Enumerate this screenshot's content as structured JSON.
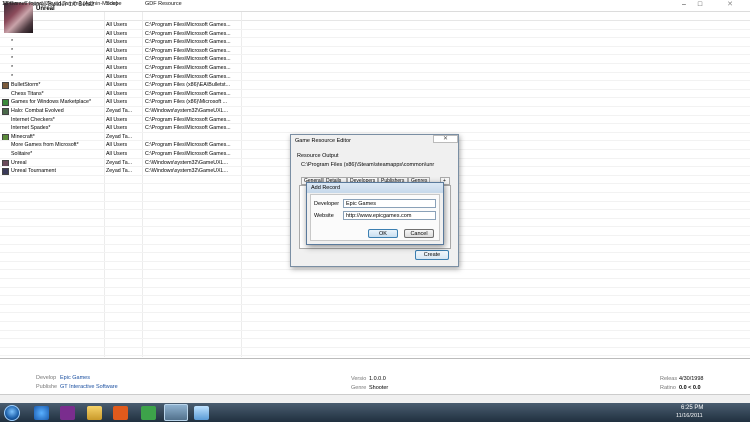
{
  "window": {
    "title": "Game Explorer Builder 1.0 Beta2",
    "min_glyph": "–",
    "max_glyph": "□",
    "close_glyph": "✕"
  },
  "list": {
    "columns": [
      "Name",
      "Scope",
      "GDF Resource"
    ],
    "rows": [
      {
        "name": "*",
        "scope": "All Users",
        "gdf": "C:\\Program Files\\Microsoft Games...",
        "icon": ""
      },
      {
        "name": "*",
        "scope": "All Users",
        "gdf": "C:\\Program Files\\Microsoft Games...",
        "icon": ""
      },
      {
        "name": "*",
        "scope": "All Users",
        "gdf": "C:\\Program Files\\Microsoft Games...",
        "icon": ""
      },
      {
        "name": "*",
        "scope": "All Users",
        "gdf": "C:\\Program Files\\Microsoft Games...",
        "icon": ""
      },
      {
        "name": "*",
        "scope": "All Users",
        "gdf": "C:\\Program Files\\Microsoft Games...",
        "icon": ""
      },
      {
        "name": "*",
        "scope": "All Users",
        "gdf": "C:\\Program Files\\Microsoft Games...",
        "icon": ""
      },
      {
        "name": "*",
        "scope": "All Users",
        "gdf": "C:\\Program Files\\Microsoft Games...",
        "icon": ""
      },
      {
        "name": "BulletStorm*",
        "scope": "All Users",
        "gdf": "C:\\Program Files (x86)\\EA\\Bulletst...",
        "icon": "#7a5a3a"
      },
      {
        "name": "Chess Titans*",
        "scope": "All Users",
        "gdf": "C:\\Program Files\\Microsoft Games...",
        "icon": ""
      },
      {
        "name": "Games for Windows Marketplace*",
        "scope": "All Users",
        "gdf": "C:\\Program Files (x86)\\Microsoft ...",
        "icon": "#3a8a3a"
      },
      {
        "name": "Halo: Combat Evolved",
        "scope": "Zeyad Ta...",
        "gdf": "C:\\Windows\\system32\\GameUXL...",
        "icon": "#4a6a4a"
      },
      {
        "name": "Internet Checkers*",
        "scope": "All Users",
        "gdf": "C:\\Program Files\\Microsoft Games...",
        "icon": ""
      },
      {
        "name": "Internet Spades*",
        "scope": "All Users",
        "gdf": "C:\\Program Files\\Microsoft Games...",
        "icon": ""
      },
      {
        "name": "Minecraft*",
        "scope": "Zeyad Ta...",
        "gdf": "",
        "icon": "#5a8a3a"
      },
      {
        "name": "More Games from Microsoft*",
        "scope": "All Users",
        "gdf": "C:\\Program Files\\Microsoft Games...",
        "icon": ""
      },
      {
        "name": "Solitaire*",
        "scope": "All Users",
        "gdf": "C:\\Program Files\\Microsoft Games...",
        "icon": ""
      },
      {
        "name": "Unreal",
        "scope": "Zeyad Ta...",
        "gdf": "C:\\Windows\\system32\\GameUXL...",
        "icon": "#6a4a5a"
      },
      {
        "name": "Unreal Tournament",
        "scope": "Zeyad Ta...",
        "gdf": "C:\\Windows\\system32\\GameUXL...",
        "icon": "#3a3a5a"
      }
    ]
  },
  "details": {
    "title": "Unreal",
    "developer_label": "Develop",
    "developer": "Epic Games",
    "publisher_label": "Publishe",
    "publisher": "GT Interactive Software",
    "version_label": "Versio",
    "version": "1.0.0.0",
    "genre_label": "Genre",
    "genre": "Shooter",
    "release_label": "Releas",
    "release": "4/30/1998",
    "rating_label": "Ratino",
    "rating": "0.0 < 0.0"
  },
  "status": "18 Games found [Zeyad Tamimi] (Admin-Mode)",
  "resource_editor": {
    "title": "Game Resource Editor",
    "close_glyph": "✕",
    "group_label": "Resource Output",
    "output_path": "C:\\Program Files (x86)\\Steam\\steamapps\\common\\unr",
    "tabs": [
      "General",
      "Details",
      "Developers",
      "Publishers",
      "Genres",
      "+"
    ],
    "create_label": "Create"
  },
  "add_record": {
    "title": "Add Record",
    "developer_label": "Developer",
    "developer_value": "Epic Games",
    "website_label": "Website",
    "website_value": "http://www.epicgames.com",
    "ok_label": "OK",
    "cancel_label": "Cancel"
  },
  "taskbar": {
    "time": "6:25 PM",
    "date": "11/16/2011"
  }
}
